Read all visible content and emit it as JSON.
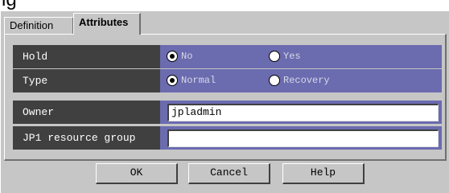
{
  "top_text": "ig",
  "tabs": [
    {
      "label": "Definition"
    },
    {
      "label": "Attributes"
    }
  ],
  "rows": {
    "hold": {
      "label": "Hold",
      "options": [
        {
          "label": "No",
          "selected": true
        },
        {
          "label": "Yes",
          "selected": false
        }
      ]
    },
    "type": {
      "label": "Type",
      "options": [
        {
          "label": "Normal",
          "selected": true
        },
        {
          "label": "Recovery",
          "selected": false
        }
      ]
    },
    "owner": {
      "label": "Owner",
      "value": "jpladmin"
    },
    "group": {
      "label": "JP1 resource group",
      "value": ""
    }
  },
  "buttons": {
    "ok": "OK",
    "cancel": "Cancel",
    "help": "Help"
  },
  "colors": {
    "dialog_bg": "#c6c6c6",
    "label_bg": "#404040",
    "row_accent": "#6b6bb0"
  }
}
